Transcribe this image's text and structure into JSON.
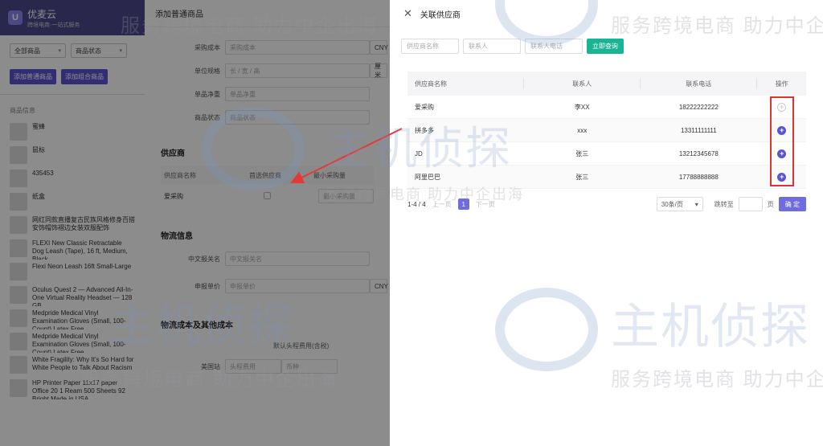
{
  "app": {
    "logo_text": "优麦云",
    "logo_sub": "跨境电商·一站式服务",
    "filters": [
      "全部商品",
      "商品状态"
    ],
    "buttons": [
      "添加普通商品",
      "添加组合商品"
    ],
    "product_header": "商品信息",
    "products": [
      "蜜蜂",
      "鼠标",
      "435453",
      "纸盒",
      "网红同款直播复古民族风格修身百搭安饰帽饰褶边女装双服配饰",
      "FLEXI New Classic Retractable Dog Leash (Tape), 16 ft, Medium, Black",
      "Flexi Neon Leash 16ft Small-Large",
      "Oculus Quest 2 — Advanced All-In-One Virtual Reality Headset — 128 GB",
      "Medpride Medical Vinyl Examination Gloves (Small, 100-Count) Latex Free",
      "Medpride Medical Vinyl Examination Gloves (Small, 100-Count) Latex Free",
      "White Fragility: Why It's So Hard for White People to Talk About Racism",
      "HP Printer Paper 11x17 paper Office 20 1 Ream 500 Sheets 92 Bright Made in USA"
    ]
  },
  "form": {
    "title": "添加普通商品",
    "fields": [
      {
        "label": "采购成本",
        "placeholder": "采购成本",
        "suffix": "CNY"
      },
      {
        "label": "单位规格",
        "placeholder": "长 / 宽 / 高",
        "suffix": "厘米"
      },
      {
        "label": "单品净重",
        "placeholder": "单品净重"
      },
      {
        "label": "商品状态",
        "placeholder": "商品状态"
      }
    ],
    "supplier_section": "供应商",
    "supplier_cols": [
      "供应商名称",
      "首选供应商",
      "最小采购量"
    ],
    "supplier_row": {
      "name": "爱采购",
      "moq_placeholder": "最小采购量"
    },
    "logistics_section": "物流信息",
    "logistics_fields": [
      {
        "label": "中文报关名",
        "placeholder": "中文报关名"
      },
      {
        "label": "申报单价",
        "placeholder": "申报单价",
        "suffix": "CNY"
      }
    ],
    "cost_section": "物流成本及其他成本",
    "cost_col": "默认头程费用(含税)",
    "site": "美国站",
    "site_placeholders": [
      "头程费用",
      "币种"
    ]
  },
  "drawer": {
    "title": "关联供应商",
    "search": {
      "name_placeholder": "供应商名称",
      "contact_placeholder": "联系人",
      "phone_placeholder": "联系人电话",
      "query_button": "立即查询"
    },
    "columns": [
      "供应商名称",
      "联系人",
      "联系电话",
      "操作"
    ],
    "rows": [
      {
        "name": "爱采购",
        "contact": "李XX",
        "phone": "18222222222",
        "added": true
      },
      {
        "name": "拼多多",
        "contact": "xxx",
        "phone": "13311111111",
        "added": false
      },
      {
        "name": "JD",
        "contact": "张三",
        "phone": "13212345678",
        "added": false
      },
      {
        "name": "阿里巴巴",
        "contact": "张三",
        "phone": "17788888888",
        "added": false
      }
    ],
    "pager": {
      "total": "1-4 / 4",
      "prev": "上一页",
      "page": "1",
      "next": "下一页",
      "page_size": "30条/页",
      "jump_label": "跳转至",
      "jump_unit": "页",
      "confirm": "确 定"
    }
  },
  "watermark": {
    "text": "服务跨境电商 助力中企出海",
    "brand": "主机侦探"
  },
  "colors": {
    "accent": "#5b55d6",
    "query": "#1ab394",
    "highlight": "#e0322f"
  }
}
